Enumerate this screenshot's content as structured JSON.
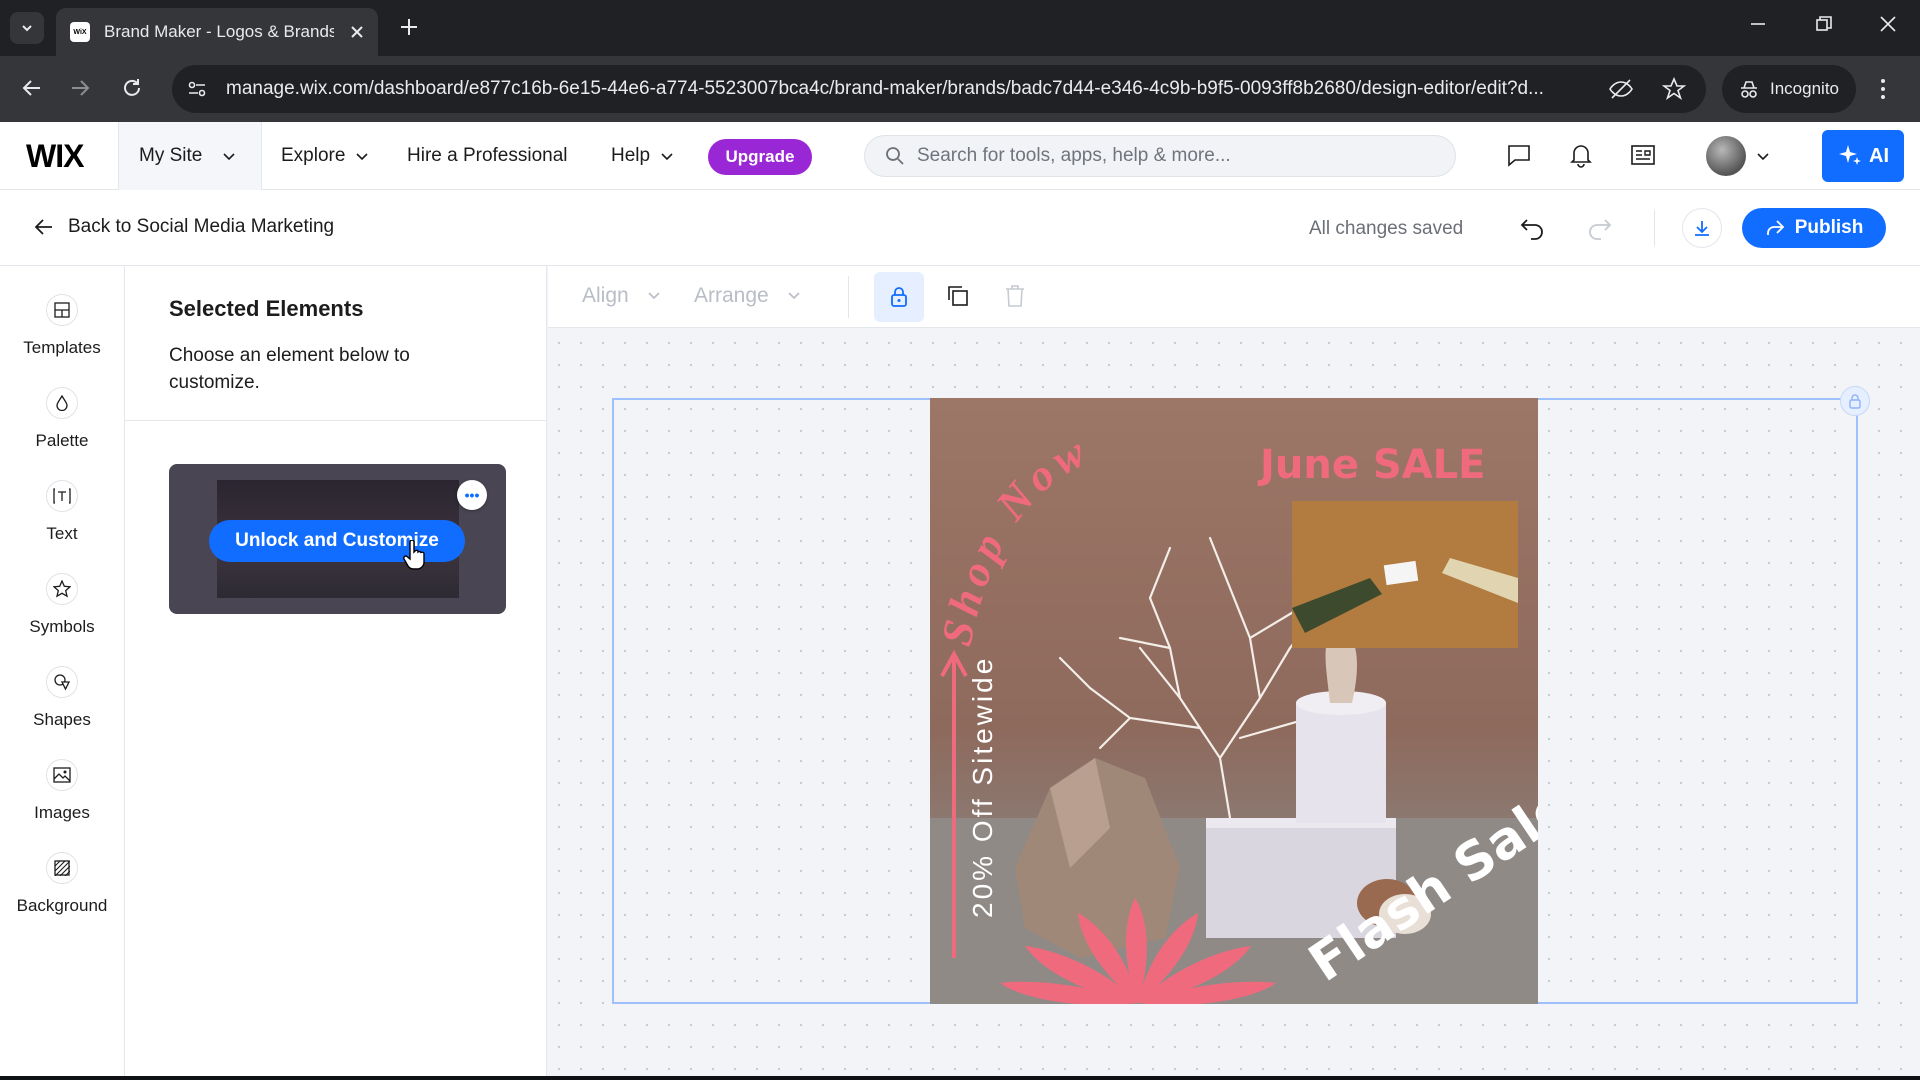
{
  "browser": {
    "tab_title": "Brand Maker - Logos & Brands",
    "favicon_text": "WiX",
    "url": "manage.wix.com/dashboard/e877c16b-6e15-44e6-a774-5523007bca4c/brand-maker/brands/badc7d44-e346-4c9b-b9f5-0093ff8b2680/design-editor/edit?d...",
    "incognito_label": "Incognito"
  },
  "header": {
    "logo": "WIX",
    "site_menu": "My Site",
    "nav": {
      "explore": "Explore",
      "hire": "Hire a Professional",
      "help": "Help"
    },
    "upgrade_label": "Upgrade",
    "search_placeholder": "Search for tools, apps, help & more...",
    "ai_label": "AI"
  },
  "subheader": {
    "back_label": "Back to Social Media Marketing",
    "status": "All changes saved",
    "publish_label": "Publish"
  },
  "sidebar": {
    "items": [
      {
        "label": "Templates",
        "icon": "templates-icon"
      },
      {
        "label": "Palette",
        "icon": "palette-icon"
      },
      {
        "label": "Text",
        "icon": "text-icon"
      },
      {
        "label": "Symbols",
        "icon": "star-icon"
      },
      {
        "label": "Shapes",
        "icon": "shapes-icon"
      },
      {
        "label": "Images",
        "icon": "image-icon"
      },
      {
        "label": "Background",
        "icon": "background-icon"
      }
    ]
  },
  "panel": {
    "title": "Selected Elements",
    "description": "Choose an element below to customize.",
    "card_button": "Unlock and Customize",
    "more_label": "•••"
  },
  "toolbar": {
    "align_label": "Align",
    "arrange_label": "Arrange"
  },
  "poster": {
    "shop_now": "Shop Now",
    "june_sale": "June SALE",
    "sitewide": "20% Off Sitewide",
    "flash_sale": "Flash Sale"
  },
  "colors": {
    "accent": "#116dff",
    "upgrade": "#9a27d5",
    "poster_pink": "#f06a7e"
  }
}
